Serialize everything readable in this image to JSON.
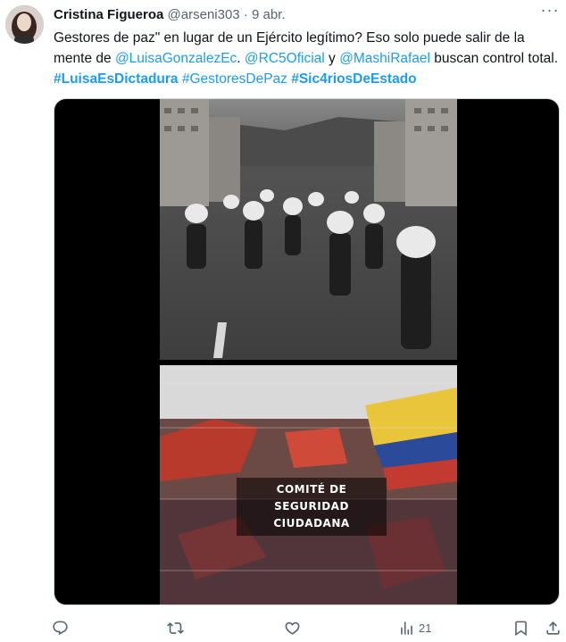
{
  "author": {
    "name": "Cristina Figueroa",
    "handle": "@arseni303",
    "separator": "·",
    "date": "9 abr."
  },
  "menu": {
    "more_label": "···"
  },
  "tweet": {
    "t1": "Gestores de paz\" en lugar de un Ejército legítimo? Eso solo puede salir de la mente de ",
    "m1": "@LuisaGonzalezEc",
    "t2": ". ",
    "m2": "@RC5Oficial",
    "t3": " y ",
    "m3": "@MashiRafael",
    "t4": " buscan control total. ",
    "h1": "#LuisaEsDictadura",
    "h2": "#GestoresDePaz",
    "h3": "#Sic4riosDeEstado"
  },
  "media": {
    "caption_line1": "COMITÉ DE SEGURIDAD",
    "caption_line2": "CIUDADANA"
  },
  "actions": {
    "views_count": "21"
  },
  "icons": {
    "reply": "reply-icon",
    "retweet": "retweet-icon",
    "like": "like-icon",
    "views": "views-icon",
    "bookmark": "bookmark-icon",
    "share": "share-icon"
  },
  "colors": {
    "link": "#1d9bf0",
    "text": "#0f1419",
    "muted": "#536471"
  }
}
